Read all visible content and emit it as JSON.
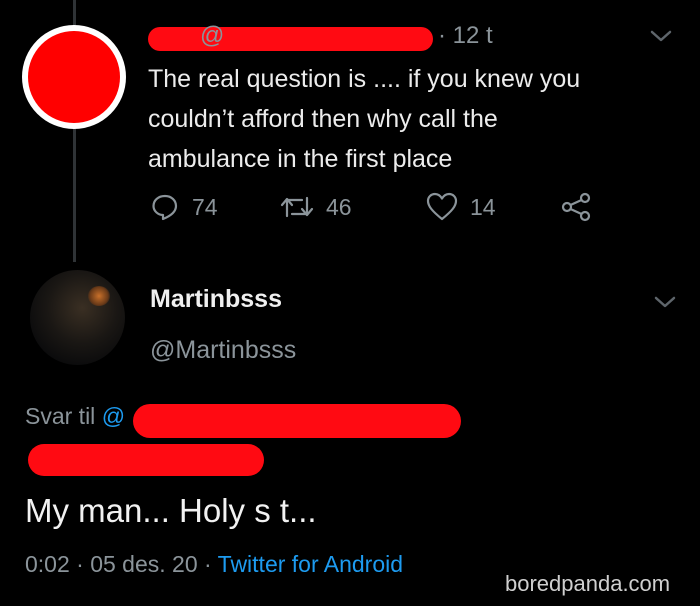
{
  "parent_tweet": {
    "handle_prefix": "@",
    "time": "· 12 t",
    "text_lines": [
      "The real question is .... if you knew you",
      "couldn’t afford then why call the",
      "ambulance in the first place"
    ],
    "actions": {
      "replies": "74",
      "retweets": "46",
      "likes": "14"
    }
  },
  "reply_tweet": {
    "display_name": "Martinbsss",
    "handle": "@Martinbsss",
    "reply_to_label": "Svar til",
    "reply_to_at": "@",
    "text": "My man... Holy s   t...",
    "timestamp": "0:02 · 05 des. 20 ·",
    "source": "Twitter for Android"
  },
  "watermark": "boredpanda.com",
  "colors": {
    "background": "#000000",
    "muted": "#8b949a",
    "link": "#1d9bf0",
    "redaction": "#ff0a12"
  },
  "icons": [
    "chevron-down-icon",
    "reply-icon",
    "retweet-icon",
    "like-icon",
    "share-icon"
  ]
}
